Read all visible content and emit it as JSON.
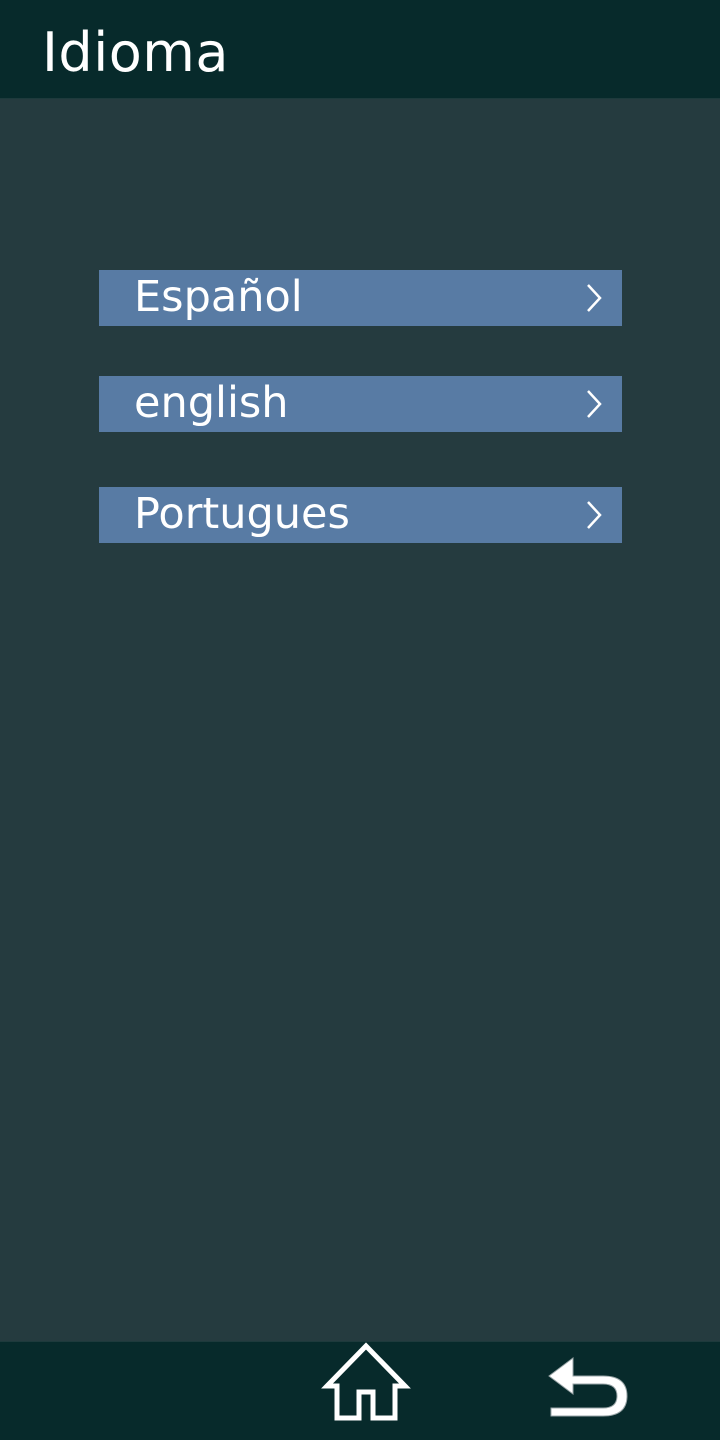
{
  "header": {
    "title": "Idioma"
  },
  "languages": [
    {
      "label": "Español",
      "icon": "chevron-right-icon"
    },
    {
      "label": "english",
      "icon": "chevron-right-icon"
    },
    {
      "label": "Portugues",
      "icon": "chevron-right-icon"
    }
  ],
  "bottom_nav": {
    "home_icon": "home-icon",
    "back_icon": "back-arrow-icon"
  },
  "colors": {
    "background": "#253b3f",
    "bars": "#072a2b",
    "item_fill": "#587ba4",
    "text": "#ffffff"
  }
}
